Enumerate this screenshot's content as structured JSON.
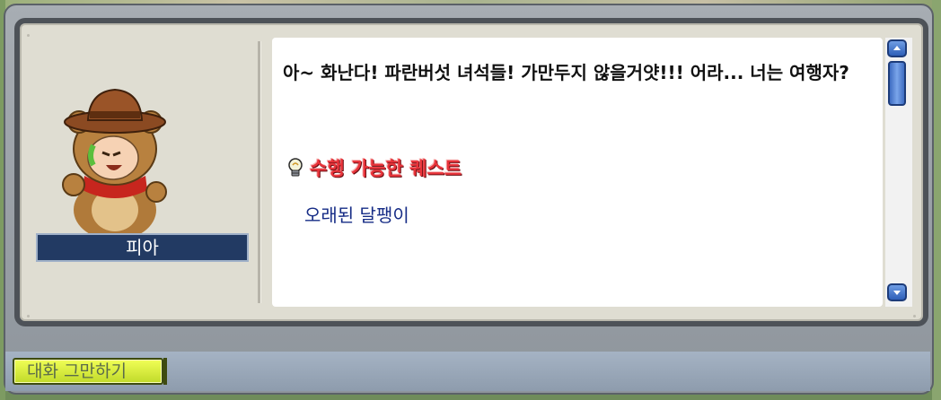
{
  "npc": {
    "name": "피아",
    "portrait_icon": "bear-hat-npc-portrait"
  },
  "dialog": {
    "text": "아~ 화난다! 파란버섯 녀석들! 가만두지 않을거얏!!! 어라... 너는 여행자?",
    "quest_header": "수행 가능한 퀘스트",
    "quest_header_icon": "lightbulb-icon",
    "quests": [
      "오래된 달팽이"
    ]
  },
  "buttons": {
    "end_chat": "대화 그만하기"
  },
  "colors": {
    "quest_header": "#e8333a",
    "quest_item": "#162c86",
    "name_plate": "#223a63",
    "end_chat_button": "#d9ee3a"
  }
}
